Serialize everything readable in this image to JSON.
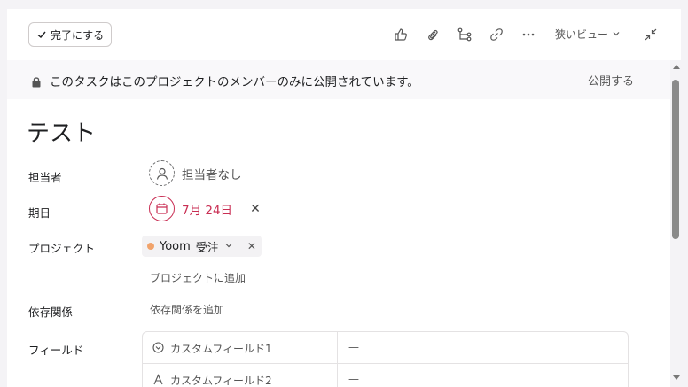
{
  "toolbar": {
    "complete_label": "完了にする",
    "view_label": "狭いビュー"
  },
  "banner": {
    "message": "このタスクはこのプロジェクトのメンバーのみに公開されています。",
    "publish_label": "公開する"
  },
  "task": {
    "title": "テスト",
    "assignee_label": "担当者",
    "assignee_value": "担当者なし",
    "due_label": "期日",
    "due_value": "7月 24日",
    "due_clear": "✕",
    "project_label": "プロジェクト",
    "project_name": "Yoom",
    "project_section": "受注",
    "project_remove": "✕",
    "add_project": "プロジェクトに追加",
    "dependencies_label": "依存関係",
    "add_dependency": "依存関係を追加",
    "fields_label": "フィールド",
    "fields": [
      {
        "name": "カスタムフィールド1",
        "icon": "dropdown-icon",
        "value": "—"
      },
      {
        "name": "カスタムフィールド2",
        "icon": "text-icon",
        "value": "—"
      }
    ]
  },
  "colors": {
    "due": "#c92f54",
    "project_dot": "#f1a36b"
  }
}
